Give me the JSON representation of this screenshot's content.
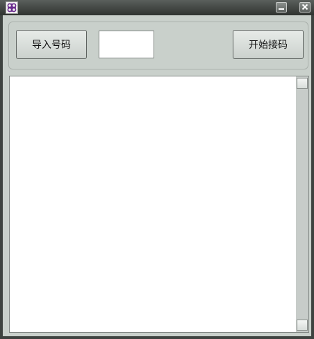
{
  "window": {
    "icon": "china-unicom-logo-icon"
  },
  "toolbar": {
    "import_label": "导入号码",
    "start_label": "开始接码",
    "code_value": ""
  },
  "output": {
    "text": ""
  },
  "colors": {
    "titlebar": "#3e4340",
    "client_bg": "#c9d0cb",
    "button_border": "#5d625f"
  }
}
